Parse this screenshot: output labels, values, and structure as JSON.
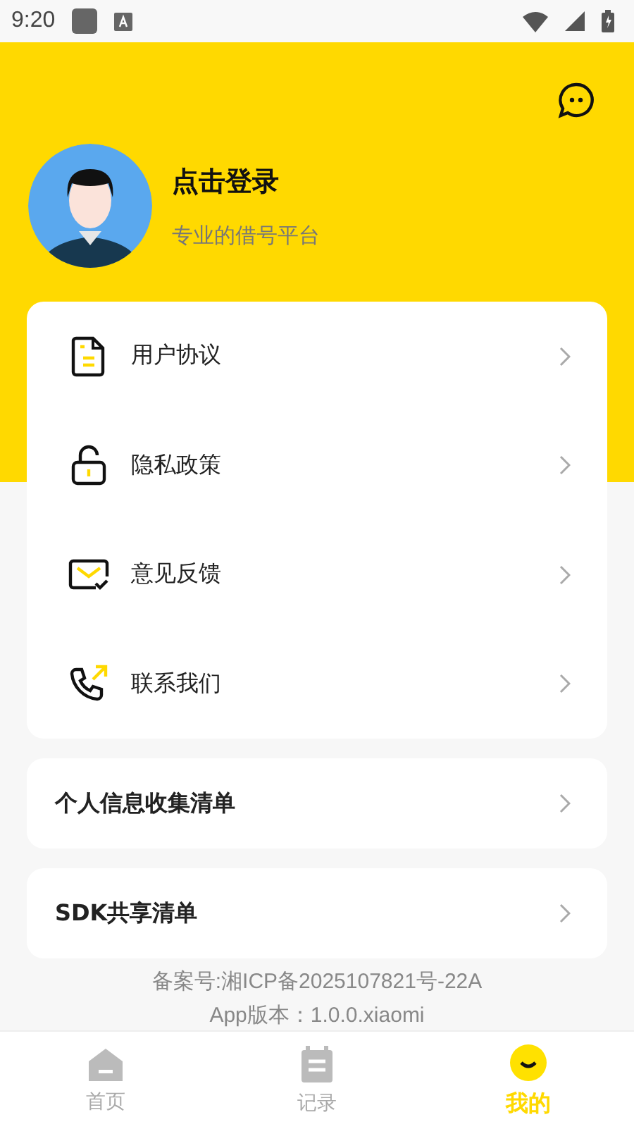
{
  "status_bar": {
    "time": "9:20"
  },
  "profile": {
    "title": "点击登录",
    "subtitle": "专业的借号平台"
  },
  "menu": [
    {
      "kind": "document",
      "label": "用户协议"
    },
    {
      "kind": "lock",
      "label": "隐私政策"
    },
    {
      "kind": "mail",
      "label": "意见反馈"
    },
    {
      "kind": "phone",
      "label": "联系我们"
    }
  ],
  "lists": [
    {
      "label": "个人信息收集清单"
    },
    {
      "label": "SDK共享清单"
    }
  ],
  "footer": {
    "record": "备案号:湘ICP备2025107821号-22A",
    "version": "App版本：1.0.0.xiaomi"
  },
  "tabs": [
    {
      "kind": "home",
      "label": "首页",
      "selected": false
    },
    {
      "kind": "record",
      "label": "记录",
      "selected": false
    },
    {
      "kind": "me",
      "label": "我的",
      "selected": true
    }
  ]
}
